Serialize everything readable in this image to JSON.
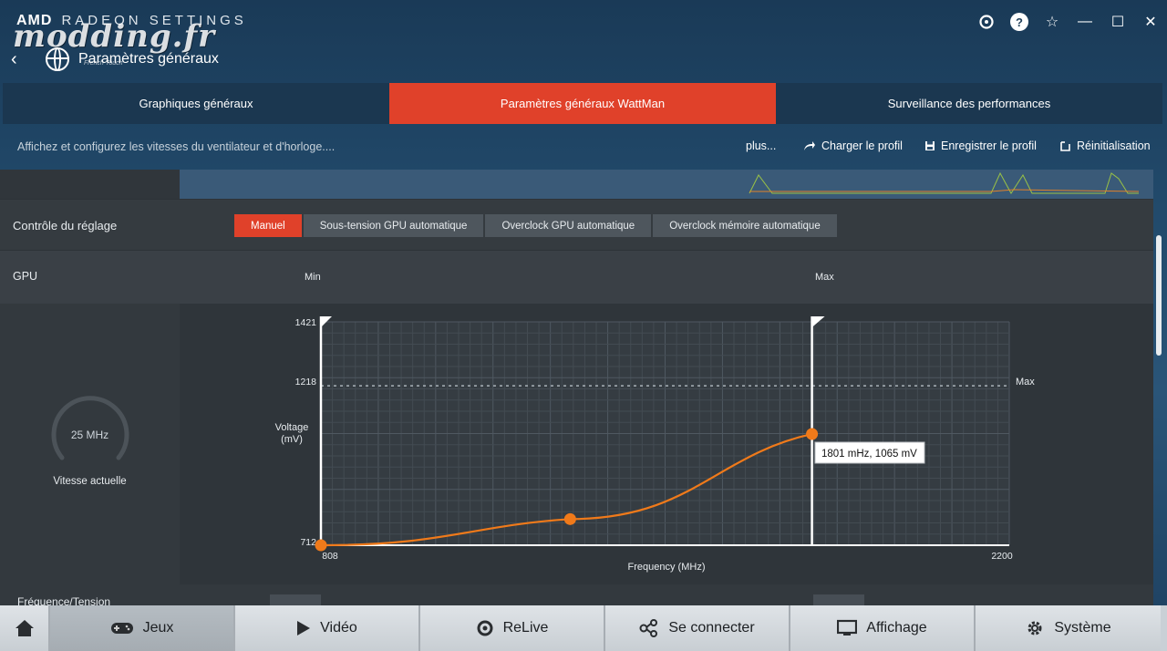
{
  "app": {
    "brand": "AMD",
    "brand_sub": "RADEON SETTINGS",
    "watermark": "modding.fr",
    "watermark_small": "French Touch",
    "page_title": "Paramètres généraux"
  },
  "tabs": [
    {
      "label": "Graphiques généraux",
      "active": false
    },
    {
      "label": "Paramètres généraux WattMan",
      "active": true
    },
    {
      "label": "Surveillance des performances",
      "active": false
    }
  ],
  "toolbar": {
    "description": "Affichez et configurez les vitesses du ventilateur et d'horloge....",
    "more": "plus...",
    "load_profile": "Charger le profil",
    "save_profile": "Enregistrer le profil",
    "reset": "Réinitialisation"
  },
  "controle": {
    "label": "Contrôle du réglage",
    "modes": [
      {
        "label": "Manuel",
        "active": true
      },
      {
        "label": "Sous-tension GPU automatique",
        "active": false
      },
      {
        "label": "Overclock GPU automatique",
        "active": false
      },
      {
        "label": "Overclock mémoire automatique",
        "active": false
      }
    ]
  },
  "gpu": {
    "label": "GPU",
    "min_label": "Min",
    "max_label": "Max",
    "gauge_value": "25 MHz",
    "gauge_label": "Vitesse actuelle"
  },
  "bottom_row": {
    "label": "Fréquence/Tension"
  },
  "chart_data": {
    "type": "line",
    "xlabel": "Frequency (MHz)",
    "ylabel_line1": "Voltage",
    "ylabel_line2": "(mV)",
    "xlim": [
      808,
      2200
    ],
    "ylim": [
      712,
      1421
    ],
    "x_ticks": [
      "808",
      "2200"
    ],
    "y_ticks": [
      "1421",
      "1218",
      "712"
    ],
    "max_line_value": 1218,
    "max_line_label": "Max",
    "points": [
      {
        "x": 808,
        "y": 712
      },
      {
        "x": 1312,
        "y": 795
      },
      {
        "x": 1801,
        "y": 1065
      }
    ],
    "min_marker_x": 808,
    "max_marker_x": 1801,
    "tooltip": "1801 mHz, 1065 mV",
    "accent": "#f07a1a"
  },
  "nav": [
    {
      "label": "Jeux",
      "icon": "gamepad-icon",
      "active": true
    },
    {
      "label": "Vidéo",
      "icon": "play-icon",
      "active": false
    },
    {
      "label": "ReLive",
      "icon": "relive-icon",
      "active": false
    },
    {
      "label": "Se connecter",
      "icon": "connect-icon",
      "active": false
    },
    {
      "label": "Affichage",
      "icon": "monitor-icon",
      "active": false
    },
    {
      "label": "Système",
      "icon": "gear-icon",
      "active": false
    }
  ],
  "colors": {
    "accent_red": "#e0412a",
    "panel": "#2d3338"
  }
}
